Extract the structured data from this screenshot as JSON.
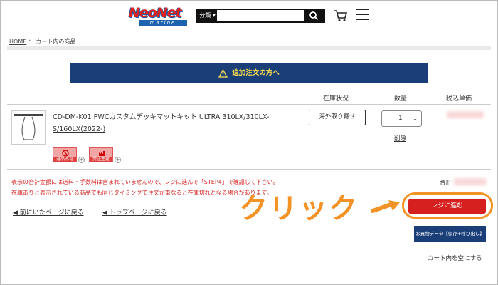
{
  "header": {
    "logo_text": "NeoNet",
    "logo_sub": "marine",
    "search_category": "分類 ▾",
    "search_placeholder": ""
  },
  "breadcrumb": {
    "home": "HOME",
    "separator": "：",
    "current": "カート内の商品"
  },
  "banner": {
    "text": "追加注文の方へ"
  },
  "table_headers": {
    "stock": "在庫状況",
    "quantity": "数量",
    "price": "税込単価"
  },
  "item": {
    "name_line1": "CD-DM-K01 PWCカスタムデッキマットキット ULTRA 310LX/310LX-",
    "name_line2": "S/160LX(2022-)",
    "badges": [
      {
        "label": "返品不可",
        "icon": "prohibited-icon"
      },
      {
        "label": "受注生産",
        "icon": "factory-icon"
      }
    ],
    "stock_button": "海外取り寄せ",
    "quantity": "1",
    "delete": "削除"
  },
  "notices": [
    "表示の合計金額には送料・手数料は含まれていませんので、レジに進んで「STEP4」で確認して下さい。",
    "在庫ありと表示されている商品でも同じタイミングで注文が重なると在庫切れとなる場合があります。"
  ],
  "total_label": "合計",
  "links": {
    "back_prev": "◀ 前にいたページに戻る",
    "back_top": "◀ トップページに戻る",
    "empty_cart": "カート内を空にする"
  },
  "annotation": {
    "text": "クリック"
  },
  "buttons": {
    "checkout": "レジに進む",
    "save": "お買物データ【保存+呼び出し】"
  },
  "colors": {
    "accent_orange": "#f39225",
    "checkout_red": "#d62020",
    "navy": "#1a3e78",
    "notice_red": "#d62828"
  }
}
